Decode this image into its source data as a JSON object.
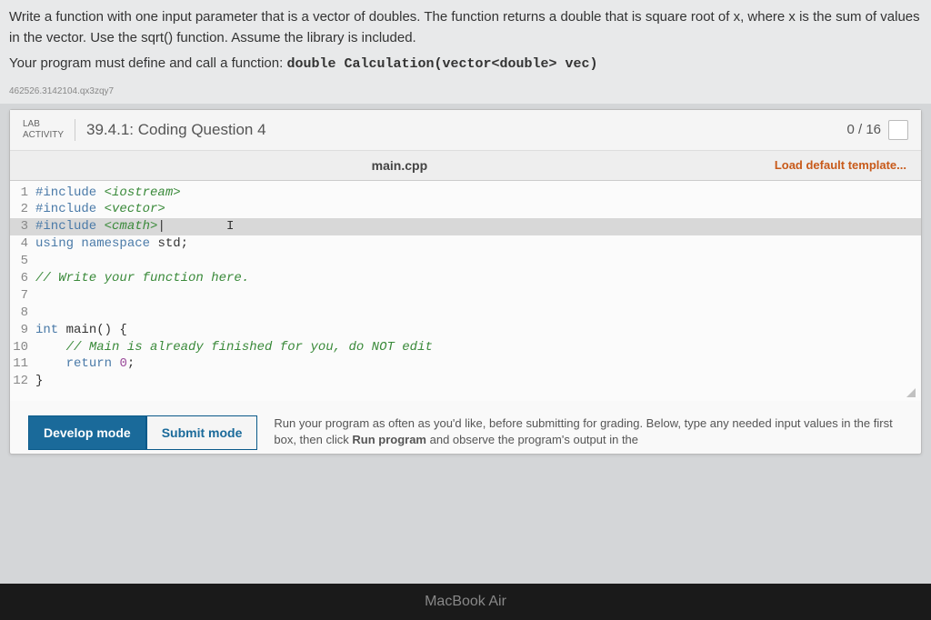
{
  "instructions": {
    "p1": "Write a function with one input parameter that is a vector of doubles. The function returns a double that is square root of x, where x is the sum of values in the vector. Use the sqrt() function. Assume the library is included.",
    "p2_prefix": "Your program must define and call a function: ",
    "p2_code": "double Calculation(vector<double> vec)"
  },
  "tiny_id": "462526.3142104.qx3zqy7",
  "lab": {
    "label_line1": "LAB",
    "label_line2": "ACTIVITY",
    "title": "39.4.1: Coding Question 4",
    "score": "0 / 16"
  },
  "file": {
    "name": "main.cpp",
    "load_template": "Load default template..."
  },
  "code": {
    "lines": [
      {
        "n": "1",
        "seg": [
          {
            "c": "kw-blue",
            "t": "#include"
          },
          {
            "c": "",
            "t": " "
          },
          {
            "c": "kw-green",
            "t": "<iostream>"
          }
        ]
      },
      {
        "n": "2",
        "seg": [
          {
            "c": "kw-blue",
            "t": "#include"
          },
          {
            "c": "",
            "t": " "
          },
          {
            "c": "kw-green",
            "t": "<vector>"
          }
        ]
      },
      {
        "n": "3",
        "hl": true,
        "seg": [
          {
            "c": "kw-blue",
            "t": "#include"
          },
          {
            "c": "",
            "t": " "
          },
          {
            "c": "kw-green",
            "t": "<cmath>"
          },
          {
            "c": "",
            "t": "|        I"
          }
        ]
      },
      {
        "n": "4",
        "seg": [
          {
            "c": "kw-blue",
            "t": "using"
          },
          {
            "c": "",
            "t": " "
          },
          {
            "c": "kw-blue",
            "t": "namespace"
          },
          {
            "c": "",
            "t": " std;"
          }
        ]
      },
      {
        "n": "5",
        "seg": []
      },
      {
        "n": "6",
        "seg": [
          {
            "c": "kw-green",
            "t": "// Write your function here."
          }
        ]
      },
      {
        "n": "7",
        "seg": []
      },
      {
        "n": "8",
        "seg": []
      },
      {
        "n": "9",
        "seg": [
          {
            "c": "kw-blue",
            "t": "int"
          },
          {
            "c": "",
            "t": " main() {"
          }
        ]
      },
      {
        "n": "10",
        "seg": [
          {
            "c": "",
            "t": "    "
          },
          {
            "c": "kw-green",
            "t": "// Main is already finished for you, do NOT edit"
          }
        ]
      },
      {
        "n": "11",
        "seg": [
          {
            "c": "",
            "t": "    "
          },
          {
            "c": "kw-blue",
            "t": "return"
          },
          {
            "c": "",
            "t": " "
          },
          {
            "c": "kw-purple",
            "t": "0"
          },
          {
            "c": "",
            "t": ";"
          }
        ]
      },
      {
        "n": "12",
        "seg": [
          {
            "c": "",
            "t": "}"
          }
        ]
      }
    ]
  },
  "modes": {
    "develop": "Develop mode",
    "submit": "Submit mode",
    "help_prefix": "Run your program as often as you'd like, before submitting for grading. Below, type any needed input values in the first box, then click ",
    "help_bold": "Run program",
    "help_suffix": " and observe the program's output in the"
  },
  "laptop": "MacBook Air"
}
